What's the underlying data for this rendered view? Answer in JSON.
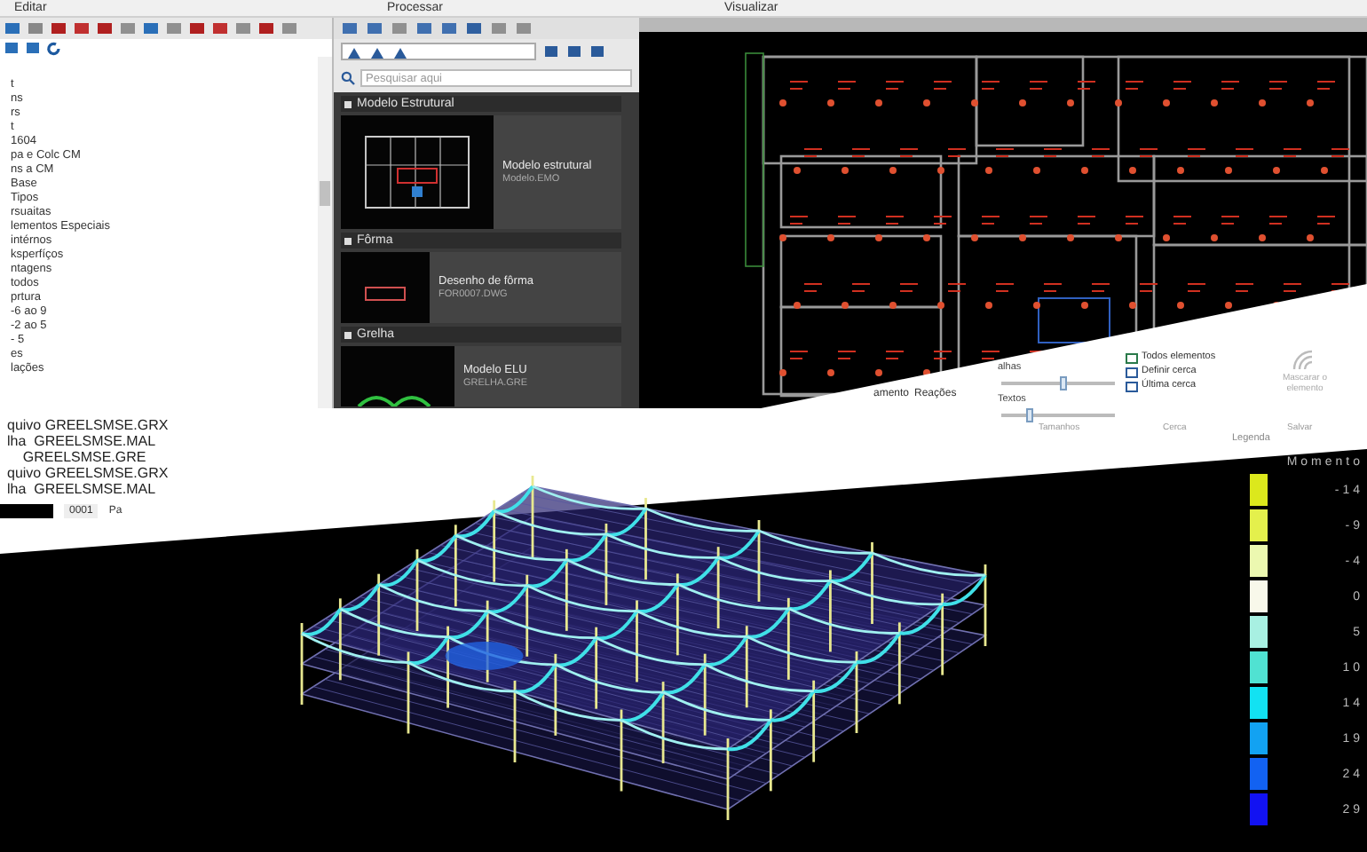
{
  "menu": [
    {
      "label": "Editar"
    },
    {
      "label": "Processar"
    },
    {
      "label": "Visualizar"
    }
  ],
  "tree_panel": {
    "items": [
      "t",
      "ns",
      "rs",
      "t",
      "1604",
      "pa e Colc CM",
      "ns a CM",
      "Base",
      "Tipos",
      "rsuaitas",
      "lementos Especiais",
      "intérnos",
      "ksperfíços",
      "ntagens",
      "todos",
      "prtura",
      "-6 ao 9",
      "-2 ao 5",
      "- 5",
      "es",
      "lações"
    ]
  },
  "library_panel": {
    "search": {
      "placeholder": "Pesquisar aqui"
    },
    "sections": [
      {
        "title": "Modelo Estrutural",
        "items": [
          {
            "title": "Modelo estrutural",
            "subtitle": "Modelo.EMO",
            "kind": "large"
          }
        ]
      },
      {
        "title": "Fôrma",
        "items": [
          {
            "title": "Desenho de fôrma",
            "subtitle": "FOR0007.DWG",
            "kind": "small"
          }
        ]
      },
      {
        "title": "Grelha",
        "items": [
          {
            "title": "Modelo ELU",
            "subtitle": "GRELHA.GRE",
            "kind": "grid"
          }
        ]
      }
    ]
  },
  "log_lines": [
    "quivo GREELSMSE.GRX",
    "lha  GREELSMSE.MAL",
    "    GREELSMSE.GRE",
    "quivo GREELSMSE.GRX",
    "lha  GREELSMSE.MAL"
  ],
  "status_strip": {
    "field": "0001",
    "label": "Pa"
  },
  "ribbon": {
    "view_buttons": [
      "amento",
      "Reações"
    ],
    "sliders": [
      {
        "label": "alhas",
        "level": 0.55
      },
      {
        "label": "Textos",
        "level": 0.25
      }
    ],
    "fence_buttons": [
      "Todos elementos",
      "Definir cerca",
      "Última cerca"
    ],
    "big_button": "Mascarar o elemento",
    "group_labels": [
      "Tamanhos",
      "Cerca",
      "Salvar"
    ]
  },
  "legend": {
    "header": "Legenda",
    "title": "Momento",
    "entries": [
      {
        "value": "-14",
        "color": "#dce81c"
      },
      {
        "value": "-9",
        "color": "#e4f04c"
      },
      {
        "value": "-4",
        "color": "#ecf8b0"
      },
      {
        "value": "0",
        "color": "#f8f8ea"
      },
      {
        "value": "5",
        "color": "#a8f0e2"
      },
      {
        "value": "10",
        "color": "#50e2d2"
      },
      {
        "value": "14",
        "color": "#12e2f2"
      },
      {
        "value": "19",
        "color": "#12a2f2"
      },
      {
        "value": "24",
        "color": "#1262f2"
      },
      {
        "value": "29",
        "color": "#1212f2"
      }
    ]
  }
}
